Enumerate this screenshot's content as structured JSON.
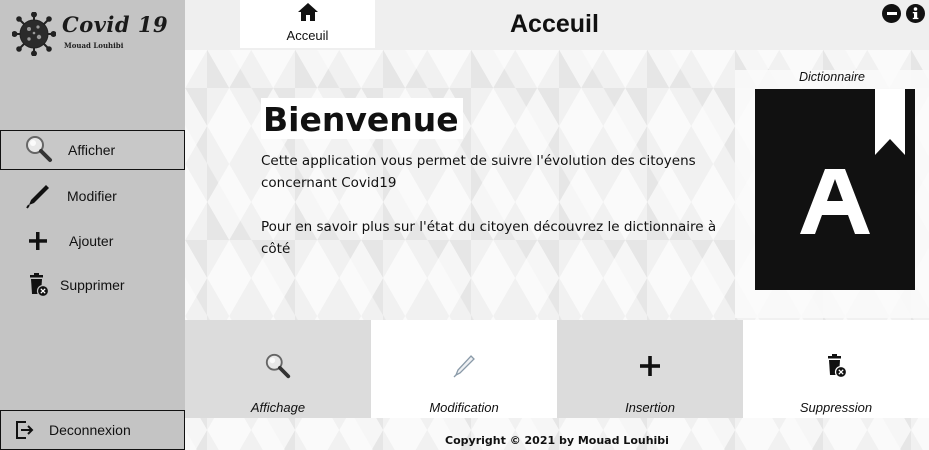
{
  "brand": {
    "title": "Covid 19",
    "subtitle": "Mouad Louhibi"
  },
  "sidebar": {
    "items": [
      {
        "label": "Afficher",
        "icon": "magnifier-icon",
        "active": true
      },
      {
        "label": "Modifier",
        "icon": "pen-icon"
      },
      {
        "label": "Ajouter",
        "icon": "plus-icon"
      },
      {
        "label": "Supprimer",
        "icon": "trash-delete-icon"
      }
    ],
    "logout": {
      "label": "Deconnexion",
      "icon": "logout-icon"
    }
  },
  "header": {
    "tab_home": {
      "label": "Acceuil",
      "icon": "home-icon"
    },
    "title": "Acceuil",
    "buttons": [
      {
        "icon": "minimize-icon"
      },
      {
        "icon": "info-icon"
      }
    ]
  },
  "main": {
    "welcome_title": "Bienvenue",
    "paragraphs": [
      "Cette application vous permet de suivre l'évolution des citoyens concernant Covid19",
      "Pour en savoir plus sur l'état du citoyen découvrez le dictionnaire à côté"
    ],
    "dictionary": {
      "label": "Dictionnaire",
      "icon": "dictionary-book-icon",
      "letter": "A"
    }
  },
  "cards": [
    {
      "label": "Affichage",
      "icon": "magnifier-icon",
      "bg": "#dcdcdc"
    },
    {
      "label": "Modification",
      "icon": "pen-icon",
      "bg": "#ffffff"
    },
    {
      "label": "Insertion",
      "icon": "plus-icon",
      "bg": "#dcdcdc"
    },
    {
      "label": "Suppression",
      "icon": "trash-delete-icon",
      "bg": "#ffffff"
    }
  ],
  "footer": {
    "text": "Copyright © 2021 by Mouad Louhibi"
  },
  "colors": {
    "sidebar_bg": "#c4c4c4",
    "header_bg": "#efefef",
    "dictionary_bg": "#111111"
  }
}
